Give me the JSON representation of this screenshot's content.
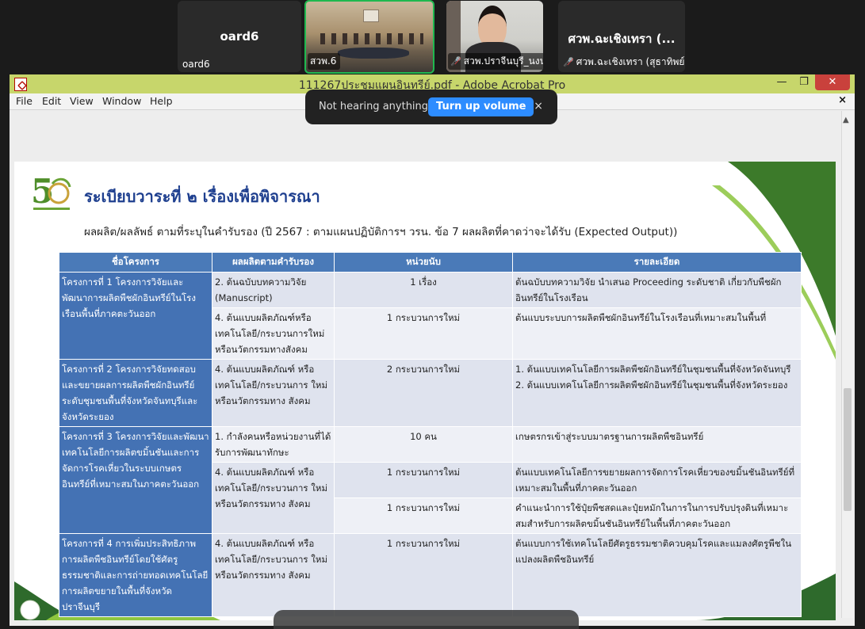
{
  "meeting": {
    "tiles": [
      {
        "big": "oard6",
        "label": "oard6"
      },
      {
        "label": "สวพ.6"
      },
      {
        "label": "สวพ.ปราจีนบุรี_นงนุช ชำ..."
      },
      {
        "big": "ศวพ.ฉะเชิงเทรา (...",
        "label": "ศวพ.ฉะเชิงเทรา (สุธาทิพย์)"
      }
    ]
  },
  "window": {
    "title": "111267ประชุมแผนอินทรีย์.pdf - Adobe Acrobat Pro",
    "controls": {
      "minimize": "—",
      "maximize": "❐",
      "close": "✕"
    },
    "doc_close": "×"
  },
  "menu": [
    "File",
    "Edit",
    "View",
    "Window",
    "Help"
  ],
  "toast": {
    "message": "Not hearing anything?",
    "button": "Turn up volume",
    "close": "×"
  },
  "slide": {
    "title": "ระเบียบวาระที่ ๒ เรื่องเพื่อพิจารณา",
    "subtitle": "ผลผลิต/ผลลัพธ์ ตามที่ระบุในคำรับรอง (ปี 2567 : ตามแผนปฏิบัติการฯ วรน. ข้อ 7 ผลผลิตที่คาดว่าจะได้รับ (Expected Output))",
    "headers": [
      "ชื่อโครงการ",
      "ผลผลิตตามคำรับรอง",
      "หน่วยนับ",
      "รายละเอียด"
    ],
    "rows": [
      {
        "project": "โครงการที่ 1 โครงการวิจัยและพัฒนาการผลิตพืชผักอินทรีย์ในโรงเรือนพื้นที่ภาคตะวันออก",
        "output": "2. ต้นฉบับบทความวิจัย (Manuscript)",
        "unit": "1 เรื่อง",
        "detail": "ต้นฉบับบทความวิจัย นำเสนอ Proceeding ระดับชาติ เกี่ยวกับพืชผักอินทรีย์ในโรงเรือน"
      },
      {
        "output": "4. ต้นแบบผลิตภัณฑ์หรือเทคโนโลยี/กระบวนการใหม่ หรือนวัตกรรมทางสังคม",
        "unit": "1 กระบวนการใหม่",
        "detail": "ต้นแบบระบบการผลิตพืชผักอินทรีย์ในโรงเรือนที่เหมาะสมในพื้นที่"
      },
      {
        "project": "โครงการที่ 2 โครงการวิจัยทดสอบและขยายผลการผลิตพืชผักอินทรีย์ระดับชุมชนพื้นที่จังหวัดจันทบุรีและจังหวัดระยอง",
        "output": "4. ต้นแบบผลิตภัณฑ์ หรือเทคโนโลยี/กระบวนการ ใหม่ หรือนวัตกรรมทาง สังคม",
        "unit": "2 กระบวนการใหม่",
        "detail": "1. ต้นแบบเทคโนโลยีการผลิตพืชผักอินทรีย์ในชุมชนพื้นที่จังหวัดจันทบุรี\n2. ต้นแบบเทคโนโลยีการผลิตพืชผักอินทรีย์ในชุมชนพื้นที่จังหวัดระยอง"
      },
      {
        "project": "โครงการที่ 3 โครงการวิจัยและพัฒนาเทคโนโลยีการผลิตขมิ้นชันและการจัดการโรคเหี่ยวในระบบเกษตรอินทรีย์ที่เหมาะสมในภาคตะวันออก",
        "output": "1. กำลังคนหรือหน่วยงานที่ได้รับการพัฒนาทักษะ",
        "unit": "10 คน",
        "detail": "เกษตรกรเข้าสู่ระบบมาตรฐานการผลิตพืชอินทรีย์"
      },
      {
        "output": "4. ต้นแบบผลิตภัณฑ์ หรือเทคโนโลยี/กระบวนการ ใหม่ หรือนวัตกรรมทาง สังคม",
        "unit": "1 กระบวนการใหม่",
        "detail": "ต้นแบบเทคโนโลยีการขยายผลการจัดการโรคเหี่ยวของขมิ้นชันอินทรีย์ที่เหมาะสมในพื้นที่ภาคตะวันออก"
      },
      {
        "unit": "1 กระบวนการใหม่",
        "detail": "คำแนะนำการใช้ปุ๋ยพืชสดและปุ๋ยหมักในการในการปรับปรุงดินที่เหมาะสมสำหรับการผลิตขมิ้นชันอินทรีย์ในพื้นที่ภาคตะวันออก"
      },
      {
        "project": "โครงการที่ 4 การเพิ่มประสิทธิภาพการผลิตพืชอินทรีย์โดยใช้ศัตรูธรรมชาติและการถ่ายทอดเทคโนโลยีการผลิตขยายในพื้นที่จังหวัดปราจีนบุรี",
        "output": "4. ต้นแบบผลิตภัณฑ์ หรือเทคโนโลยี/กระบวนการ ใหม่ หรือนวัตกรรมทาง สังคม",
        "unit": "1 กระบวนการใหม่",
        "detail": "ต้นแบบการใช้เทคโนโลยีศัตรูธรรมชาติควบคุมโรคและแมลงศัตรูพืชในแปลงผลิตพืชอินทรีย์"
      }
    ]
  },
  "colors": {
    "titlebar": "#c7d66b",
    "header": "#4a7ab8",
    "project_cell": "#4472b4",
    "accent_green": "#5a9a32"
  }
}
